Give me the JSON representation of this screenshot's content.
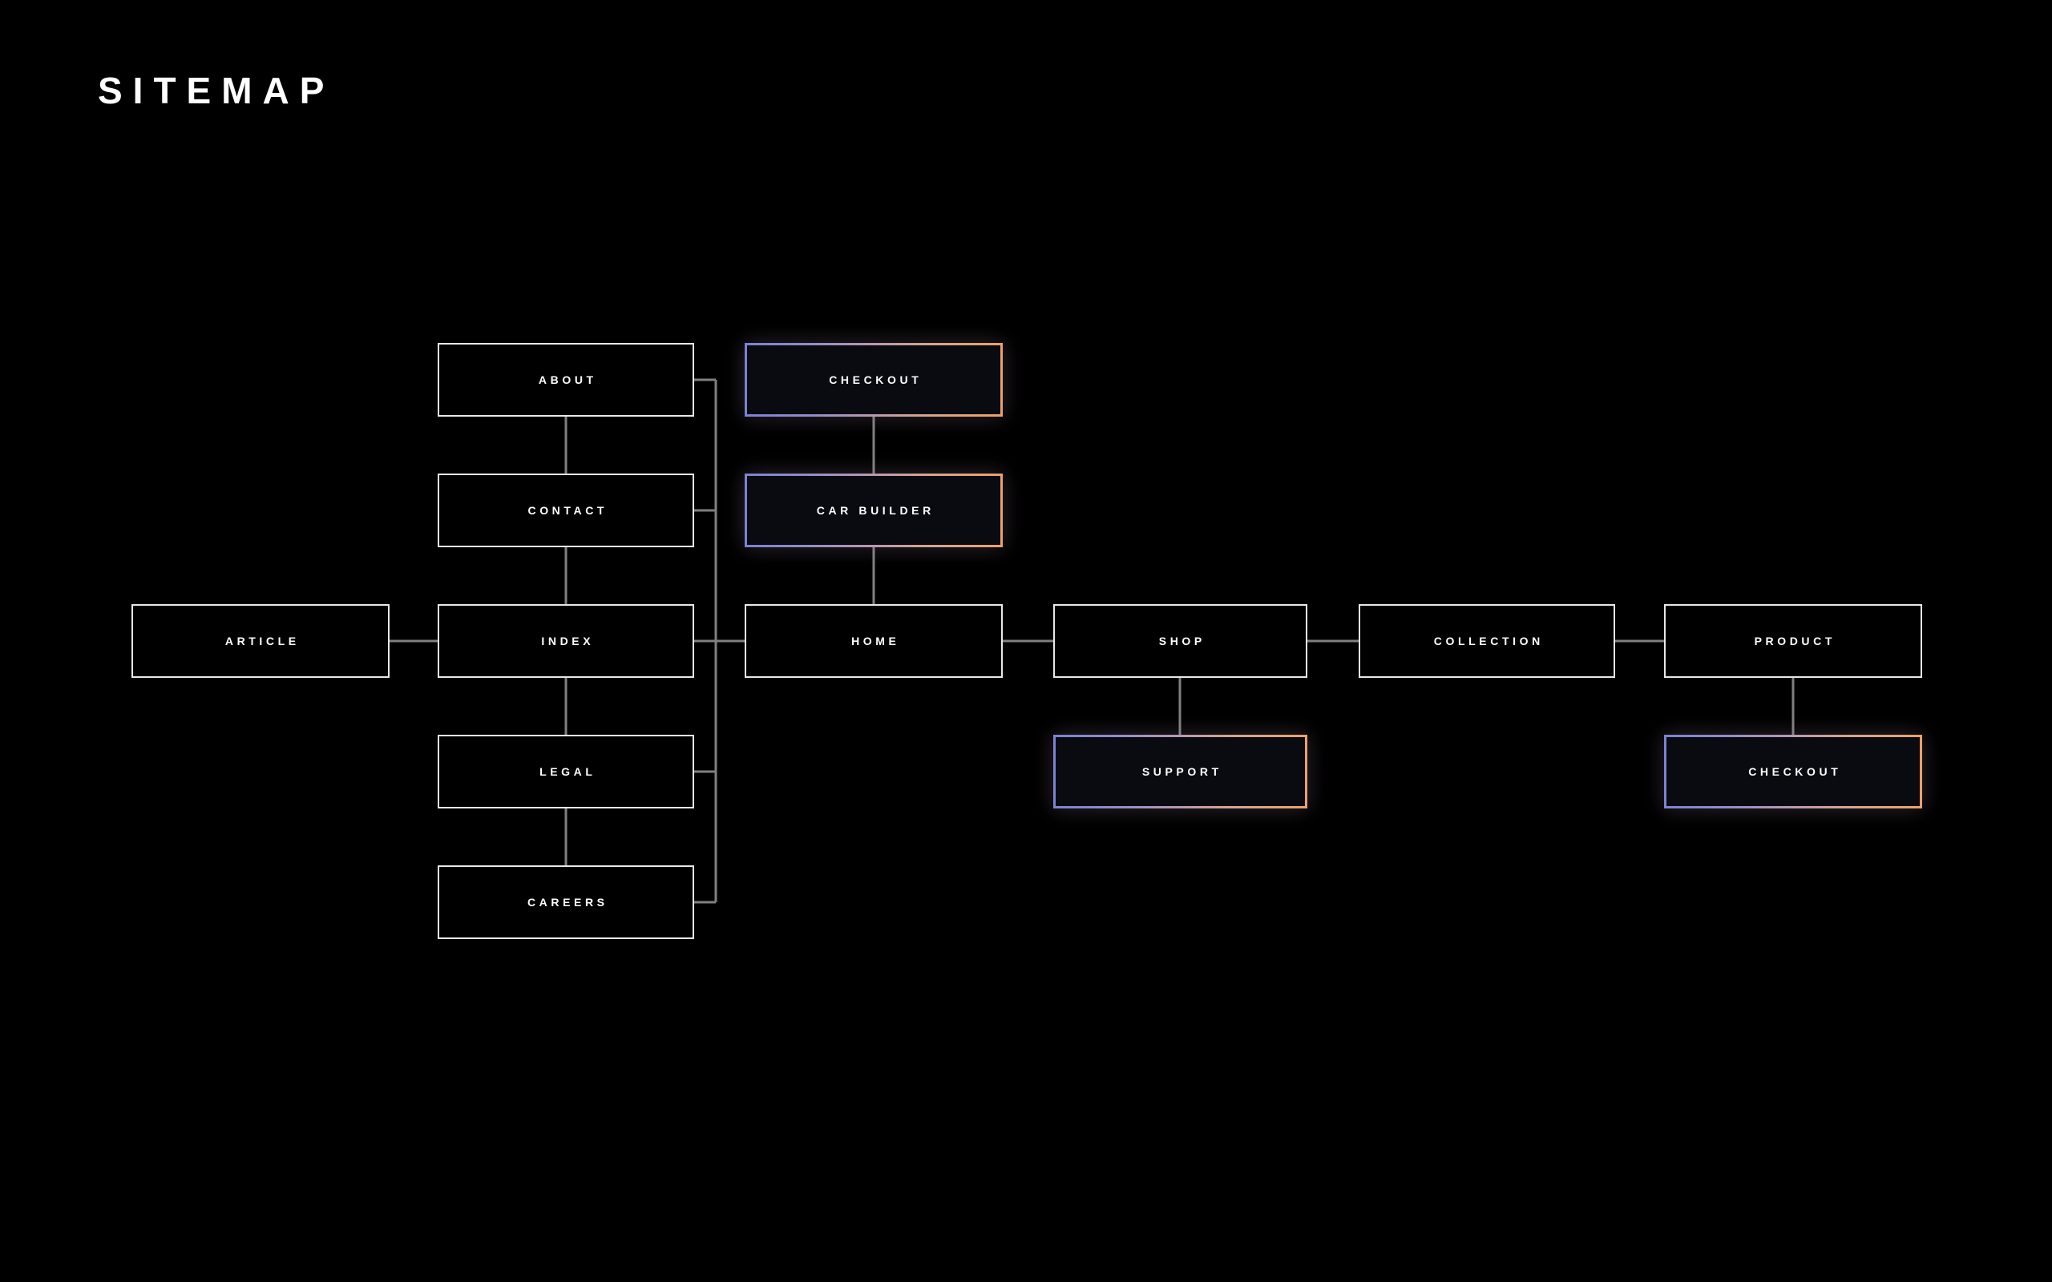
{
  "page": {
    "title": "SITEMAP",
    "background_color": "#000000",
    "node_border_color": "#e8e8e8",
    "connector_color": "#808080",
    "highlight_gradient_start": "#7b82d4",
    "highlight_gradient_end": "#eda069",
    "highlight_fill_color": "#0a0a11",
    "label_color": "#ffffff"
  },
  "nodes": {
    "about": {
      "label": "ABOUT",
      "highlight": false
    },
    "contact": {
      "label": "CONTACT",
      "highlight": false
    },
    "index": {
      "label": "INDEX",
      "highlight": false
    },
    "legal": {
      "label": "LEGAL",
      "highlight": false
    },
    "careers": {
      "label": "CAREERS",
      "highlight": false
    },
    "article": {
      "label": "ARTICLE",
      "highlight": false
    },
    "checkout_top": {
      "label": "CHECKOUT",
      "highlight": true
    },
    "car_builder": {
      "label": "CAR BUILDER",
      "highlight": true
    },
    "home": {
      "label": "HOME",
      "highlight": false
    },
    "shop": {
      "label": "SHOP",
      "highlight": false
    },
    "support": {
      "label": "SUPPORT",
      "highlight": true
    },
    "collection": {
      "label": "COLLECTION",
      "highlight": false
    },
    "product": {
      "label": "PRODUCT",
      "highlight": false
    },
    "checkout_product": {
      "label": "CHECKOUT",
      "highlight": true
    }
  },
  "connections": [
    {
      "from": "about",
      "to": "contact",
      "kind": "vertical"
    },
    {
      "from": "contact",
      "to": "index",
      "kind": "vertical"
    },
    {
      "from": "index",
      "to": "legal",
      "kind": "vertical"
    },
    {
      "from": "legal",
      "to": "careers",
      "kind": "vertical"
    },
    {
      "from": "article",
      "to": "index",
      "kind": "horizontal"
    },
    {
      "from": "about",
      "to": "trunk",
      "kind": "stub-right"
    },
    {
      "from": "contact",
      "to": "trunk",
      "kind": "stub-right"
    },
    {
      "from": "legal",
      "to": "trunk",
      "kind": "stub-right"
    },
    {
      "from": "careers",
      "to": "trunk",
      "kind": "stub-right"
    },
    {
      "from": "index",
      "to": "home",
      "kind": "horizontal"
    },
    {
      "from": "checkout_top",
      "to": "car_builder",
      "kind": "vertical"
    },
    {
      "from": "car_builder",
      "to": "home",
      "kind": "vertical"
    },
    {
      "from": "home",
      "to": "shop",
      "kind": "horizontal"
    },
    {
      "from": "shop",
      "to": "support",
      "kind": "vertical"
    },
    {
      "from": "shop",
      "to": "collection",
      "kind": "horizontal"
    },
    {
      "from": "collection",
      "to": "product",
      "kind": "horizontal"
    },
    {
      "from": "product",
      "to": "checkout_product",
      "kind": "vertical"
    }
  ]
}
